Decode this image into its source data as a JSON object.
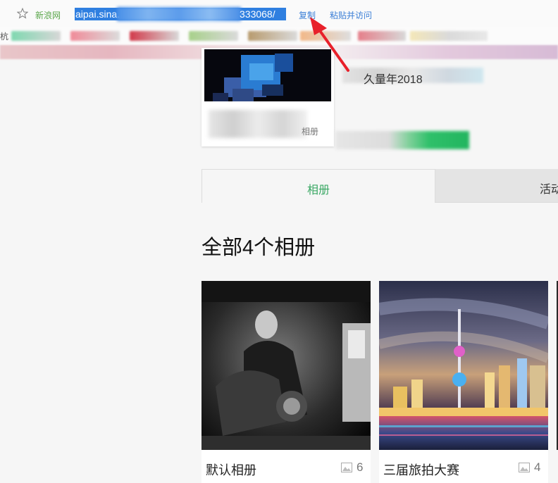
{
  "browser": {
    "site_name": "新浪网",
    "url_start": "aipai.sina.",
    "url_end": "333068/",
    "copy_label": "复制",
    "paste_visit_label": "粘贴并访问",
    "bookmark_prefix": "杭"
  },
  "profile": {
    "name_fragment": "久量年2018",
    "card_label": "相册"
  },
  "tabs": [
    {
      "label": "相册",
      "active": true
    },
    {
      "label": "活动",
      "active": false
    }
  ],
  "section_title": "全部4个相册",
  "albums": [
    {
      "name": "默认相册",
      "count": "6"
    },
    {
      "name": "三届旅拍大赛",
      "count": "4"
    }
  ],
  "colors": {
    "accent_green": "#3aa864",
    "link_blue": "#3b7fd6",
    "selection_blue": "#2f7fe0",
    "annotation_red": "#e8212b"
  },
  "icons": {
    "star": "star-icon",
    "photo": "photo-icon",
    "arrow": "annotation-arrow"
  }
}
